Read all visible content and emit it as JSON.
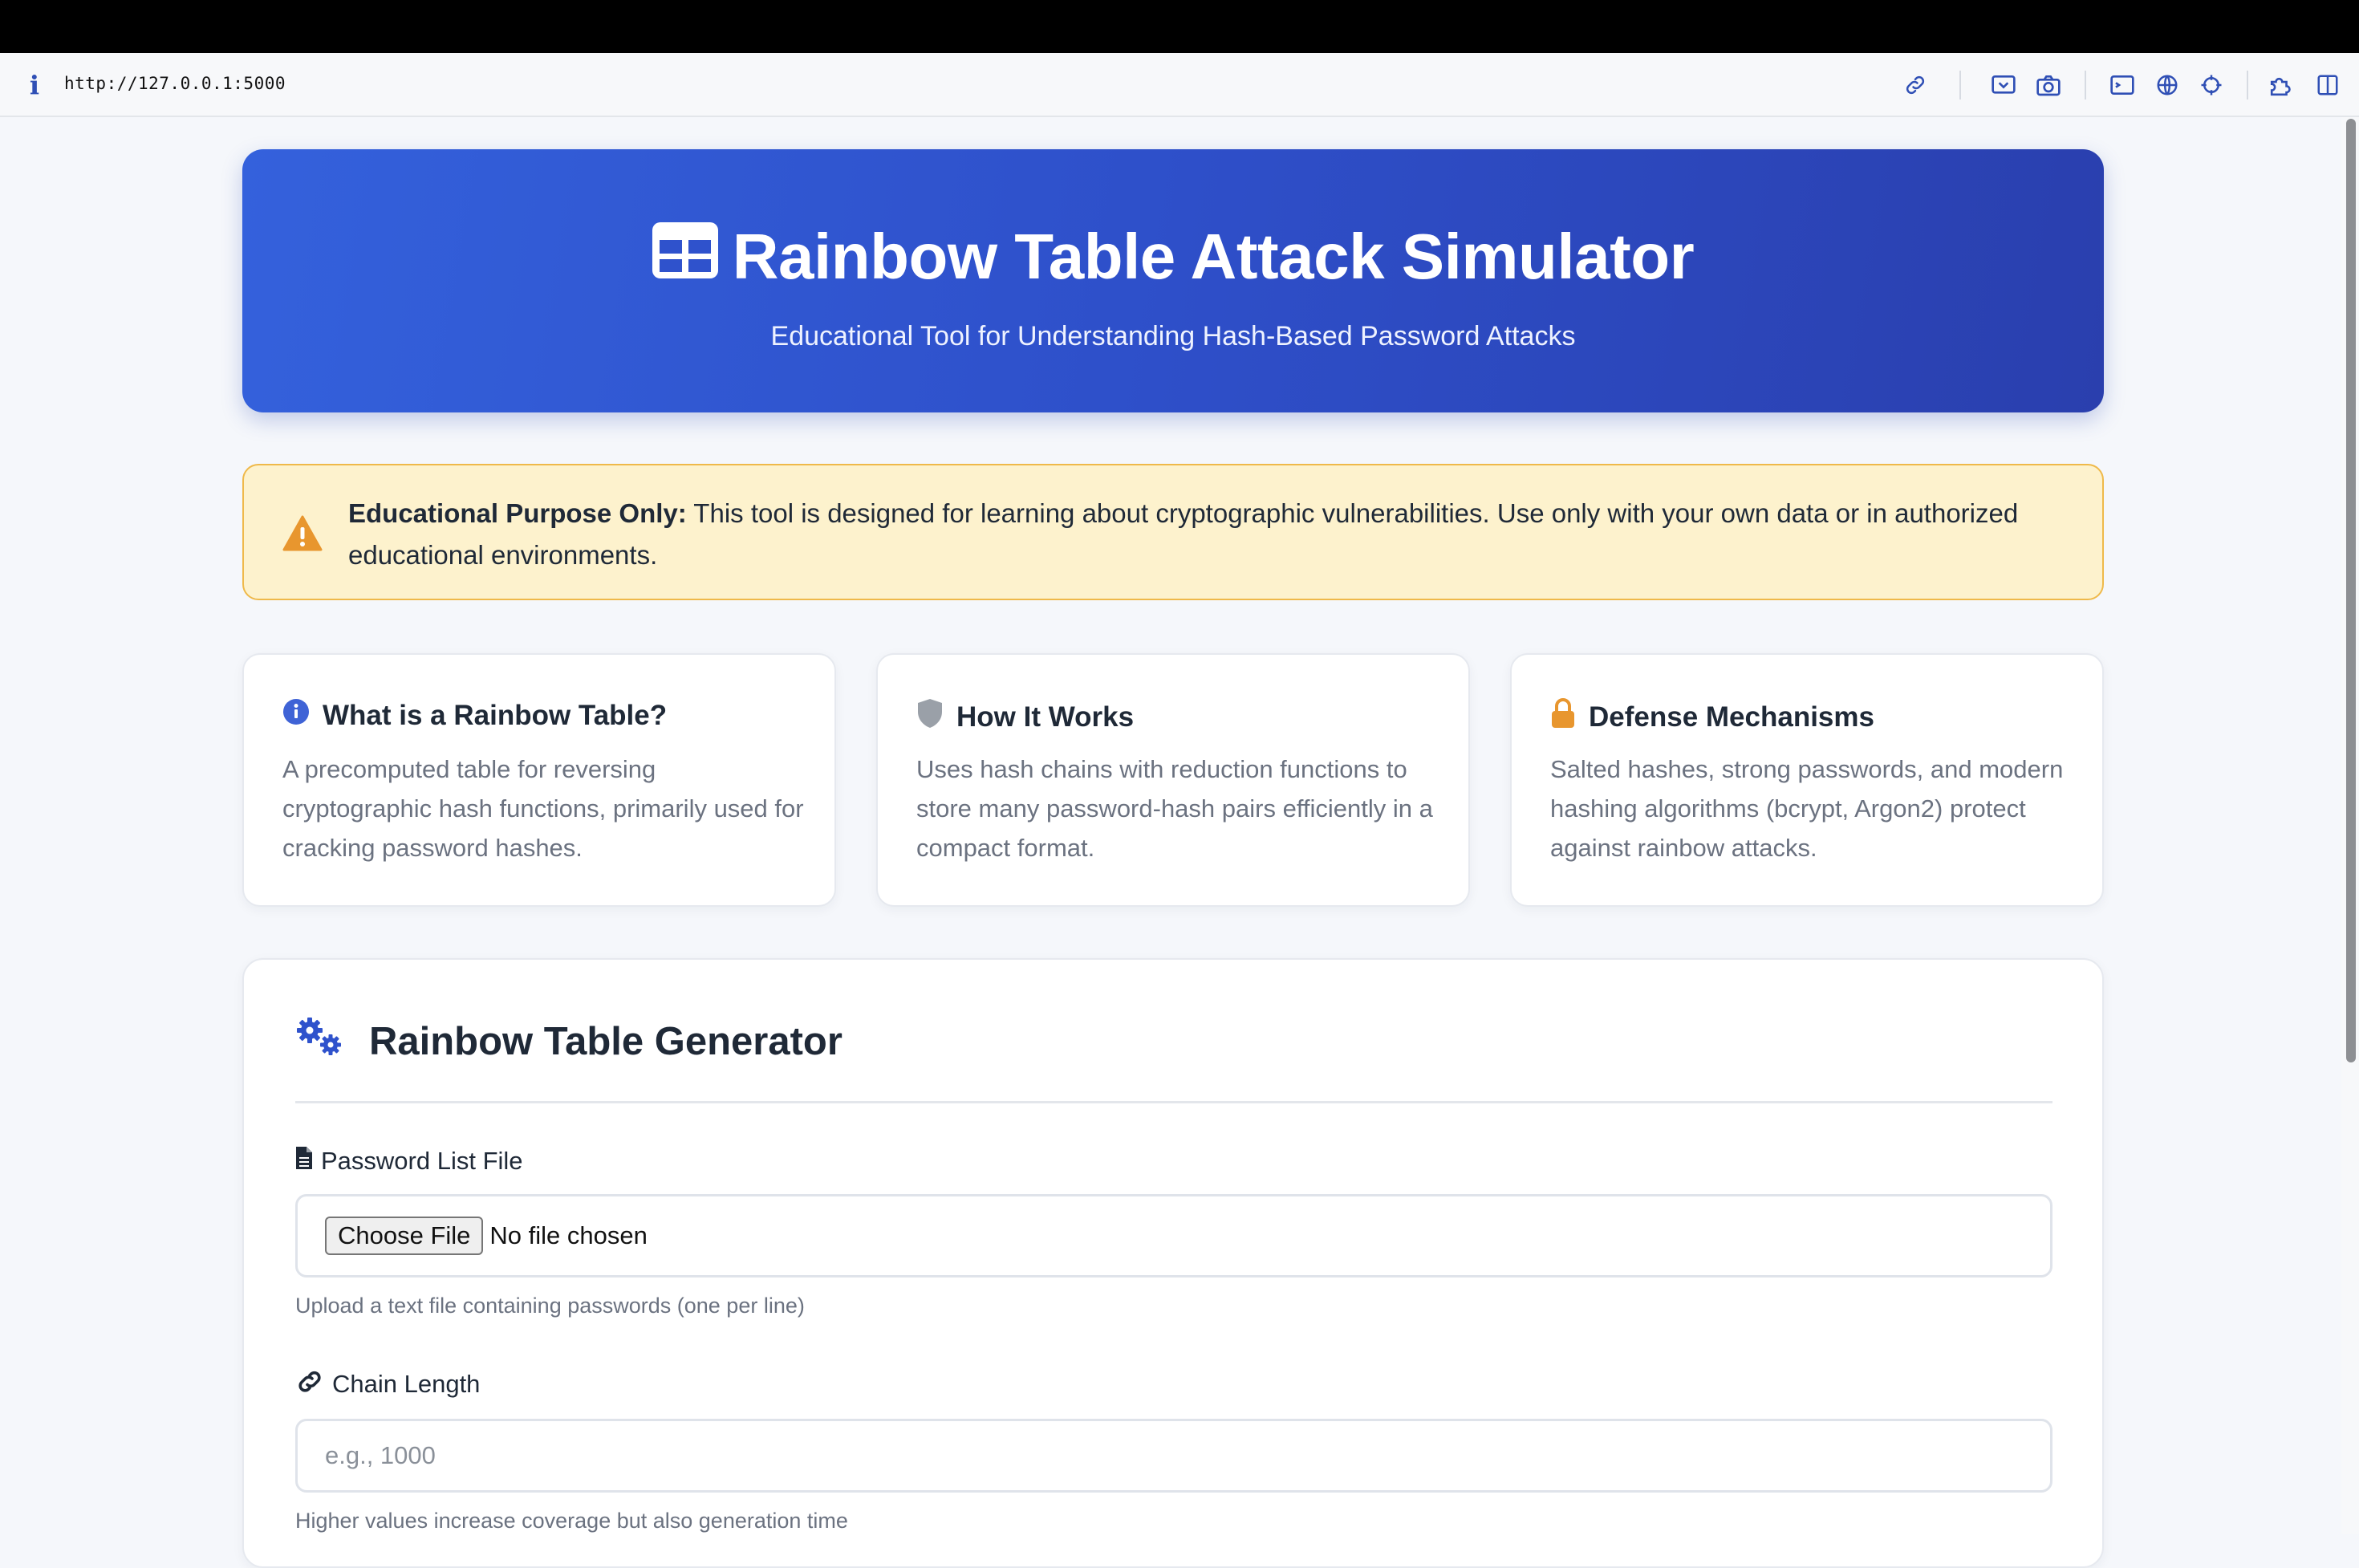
{
  "browser": {
    "url": "http://127.0.0.1:5000",
    "toolbar_icons": [
      "link-icon",
      "inspect-icon",
      "camera-icon",
      "terminal-icon",
      "globe-icon",
      "crosshair-icon",
      "extensions-icon",
      "sidebar-icon"
    ]
  },
  "hero": {
    "title": "Rainbow Table Attack Simulator",
    "subtitle": "Educational Tool for Understanding Hash-Based Password Attacks",
    "icon": "table-icon",
    "gradient_start": "#3461dc",
    "gradient_end": "#2a3fae"
  },
  "warning": {
    "title": "Educational Purpose Only:",
    "text": " This tool is designed for learning about cryptographic vulnerabilities. Use only with your own data or in authorized educational environments.",
    "icon": "warning-icon",
    "color": "#e8962e"
  },
  "cards": [
    {
      "icon": "info-circle-icon",
      "title": "What is a Rainbow Table?",
      "text": "A precomputed table for reversing cryptographic hash functions, primarily used for cracking password hashes."
    },
    {
      "icon": "shield-icon",
      "title": "How It Works",
      "text": "Uses hash chains with reduction functions to store many password-hash pairs efficiently in a compact format."
    },
    {
      "icon": "lock-icon",
      "title": "Defense Mechanisms",
      "text": "Salted hashes, strong passwords, and modern hashing algorithms (bcrypt, Argon2) protect against rainbow attacks."
    }
  ],
  "generator": {
    "title": "Rainbow Table Generator",
    "icon": "cogs-icon",
    "password_file": {
      "label": "Password List File",
      "button": "Choose File",
      "status": "No file chosen",
      "help": "Upload a text file containing passwords (one per line)"
    },
    "chain_length": {
      "label": "Chain Length",
      "placeholder": "e.g., 1000",
      "value": "",
      "help": "Higher values increase coverage but also generation time"
    }
  }
}
